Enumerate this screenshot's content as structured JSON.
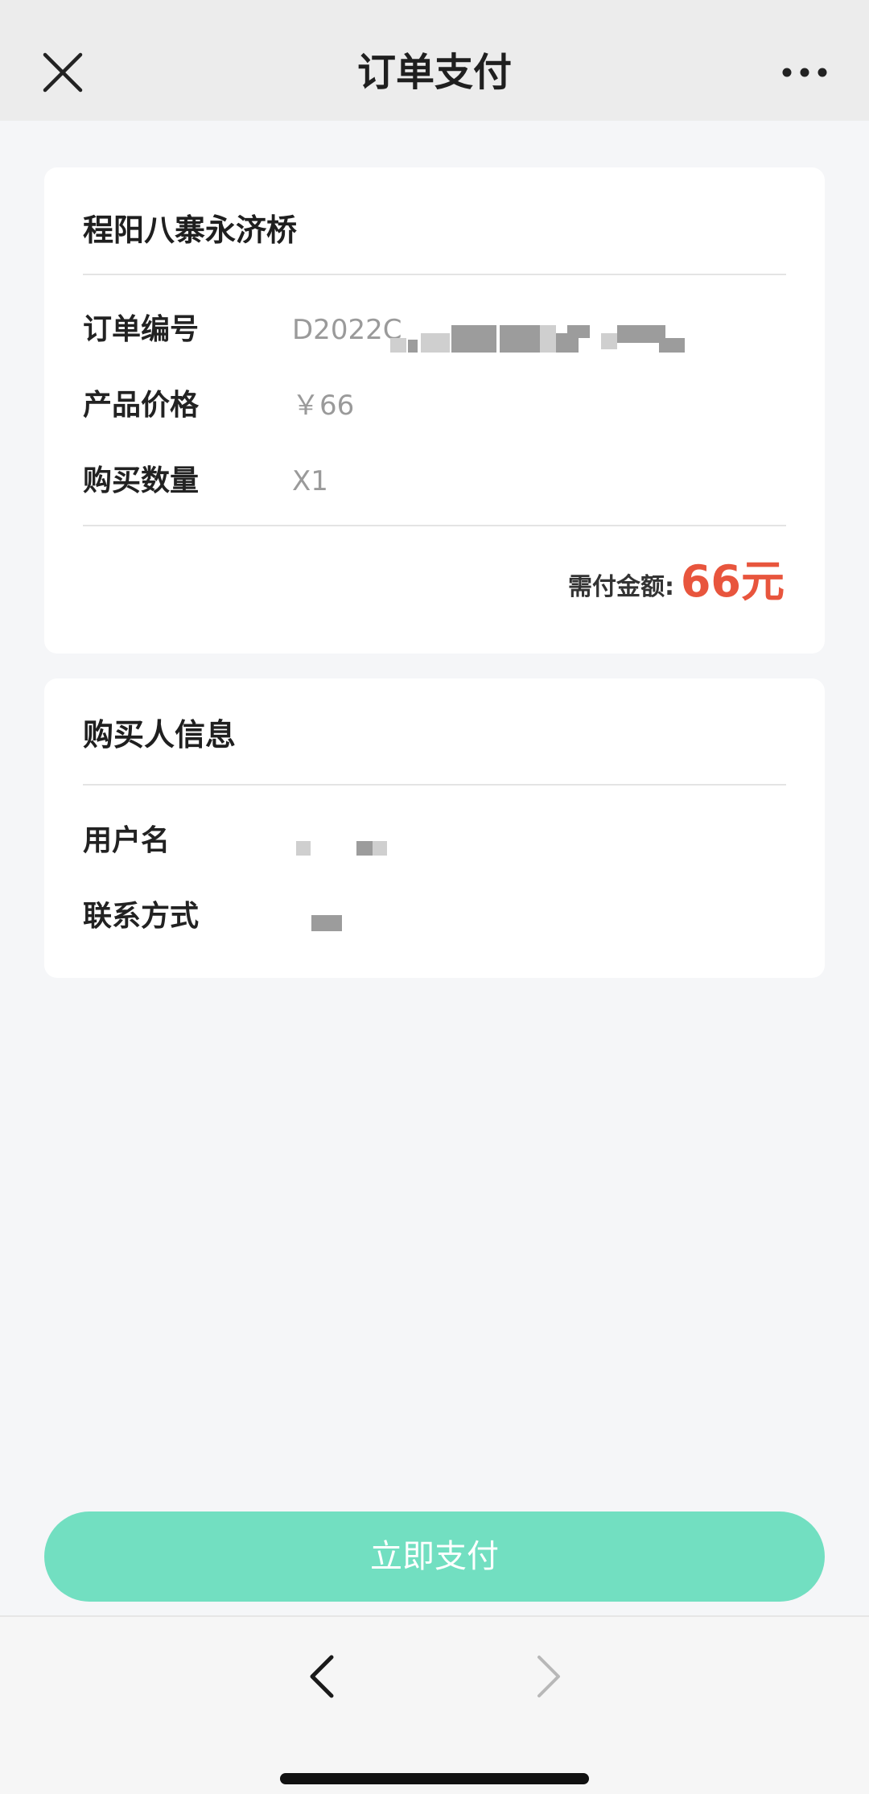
{
  "header": {
    "title": "订单支付",
    "close_icon": "close-icon",
    "more_icon": "more-dots-icon"
  },
  "order": {
    "product_name": "程阳八寨永济桥",
    "rows": [
      {
        "label": "订单编号",
        "value": "D2022C"
      },
      {
        "label": "产品价格",
        "value": "￥66"
      },
      {
        "label": "购买数量",
        "value": "X1"
      }
    ],
    "total_label": "需付金额:",
    "total_amount": "66元"
  },
  "buyer": {
    "title": "购买人信息",
    "rows": [
      {
        "label": "用户名"
      },
      {
        "label": "联系方式"
      }
    ]
  },
  "pay_button": {
    "label": "立即支付"
  },
  "bottom_nav": {
    "back_icon": "chevron-left-icon",
    "forward_icon": "chevron-right-icon"
  },
  "colors": {
    "accent_button": "#72dfc1",
    "total_red": "#e8553d",
    "page_bg": "#f5f6f8",
    "nav_bg": "#ececec"
  }
}
